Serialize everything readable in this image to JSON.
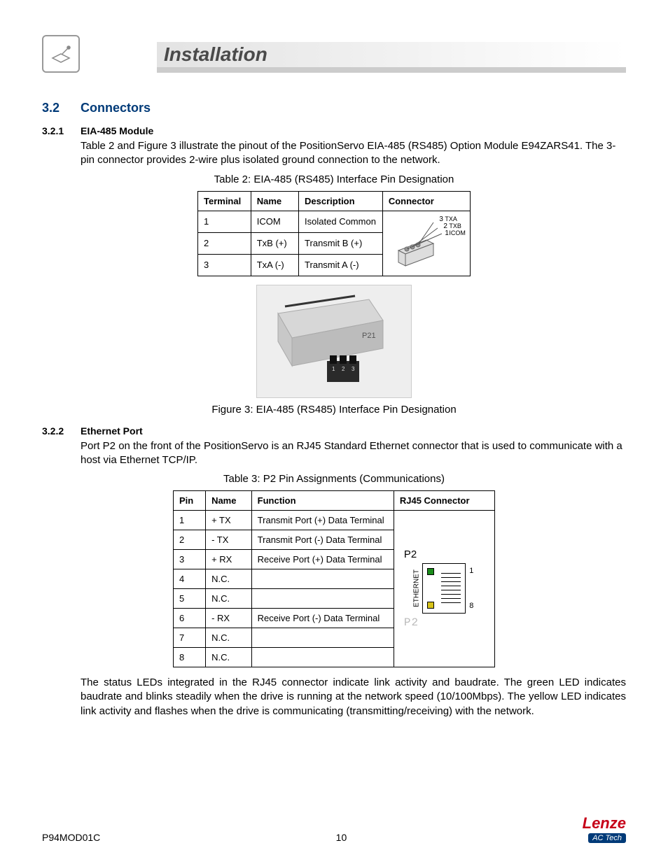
{
  "header": {
    "title": "Installation"
  },
  "section": {
    "num": "3.2",
    "title": "Connectors"
  },
  "sub1": {
    "num": "3.2.1",
    "title": "EIA-485 Module",
    "para": "Table 2 and Figure 3 illustrate the pinout of the PositionServo EIA-485 (RS485) Option Module E94ZARS41. The 3-pin connector provides 2-wire plus isolated ground connection to the network."
  },
  "table2": {
    "caption": "Table 2: EIA-485 (RS485) Interface Pin Designation",
    "headers": [
      "Terminal",
      "Name",
      "Description",
      "Connector"
    ],
    "rows": [
      {
        "terminal": "1",
        "name": "ICOM",
        "desc": "Isolated Common"
      },
      {
        "terminal": "2",
        "name": "TxB (+)",
        "desc": "Transmit B (+)"
      },
      {
        "terminal": "3",
        "name": "TxA (-)",
        "desc": "Transmit A (-)"
      }
    ],
    "connector_labels": {
      "pin3": "TXA",
      "pin_n3": "3",
      "pin2": "TXB",
      "pin_n2": "2",
      "pin1": "ICOM",
      "pin_n1": "1"
    }
  },
  "figure3": {
    "caption": "Figure 3: EIA-485 (RS485) Interface Pin Designation",
    "alt": "P21 module photo"
  },
  "sub2": {
    "num": "3.2.2",
    "title": "Ethernet Port",
    "para": "Port P2 on the front of the PositionServo is an RJ45 Standard Ethernet connector that is used to communicate with a host via Ethernet TCP/IP."
  },
  "table3": {
    "caption": "Table 3: P2 Pin Assignments (Communications)",
    "headers": [
      "Pin",
      "Name",
      "Function",
      "RJ45 Connector"
    ],
    "rows": [
      {
        "pin": "1",
        "name": "+ TX",
        "func": "Transmit Port (+) Data Terminal"
      },
      {
        "pin": "2",
        "name": "- TX",
        "func": "Transmit Port (-) Data Terminal"
      },
      {
        "pin": "3",
        "name": "+ RX",
        "func": "Receive Port (+) Data Terminal"
      },
      {
        "pin": "4",
        "name": "N.C.",
        "func": ""
      },
      {
        "pin": "5",
        "name": "N.C.",
        "func": ""
      },
      {
        "pin": "6",
        "name": "- RX",
        "func": "Receive Port (-) Data Terminal"
      },
      {
        "pin": "7",
        "name": "N.C.",
        "func": ""
      },
      {
        "pin": "8",
        "name": "N.C.",
        "func": ""
      }
    ],
    "connector": {
      "title": "P2",
      "side": "ETHERNET",
      "top": "1",
      "bottom": "8",
      "outline": "P2"
    }
  },
  "para_after_table3": "The status LEDs integrated in the RJ45 connector indicate link activity and baudrate. The green LED indicates baudrate and blinks steadily when the drive is running at the network speed (10/100Mbps). The yellow LED indicates link activity and flashes when the drive is communicating (transmitting/receiving) with the network.",
  "footer": {
    "doc": "P94MOD01C",
    "page": "10",
    "logo_main": "Lenze",
    "logo_sub": "AC Tech"
  }
}
